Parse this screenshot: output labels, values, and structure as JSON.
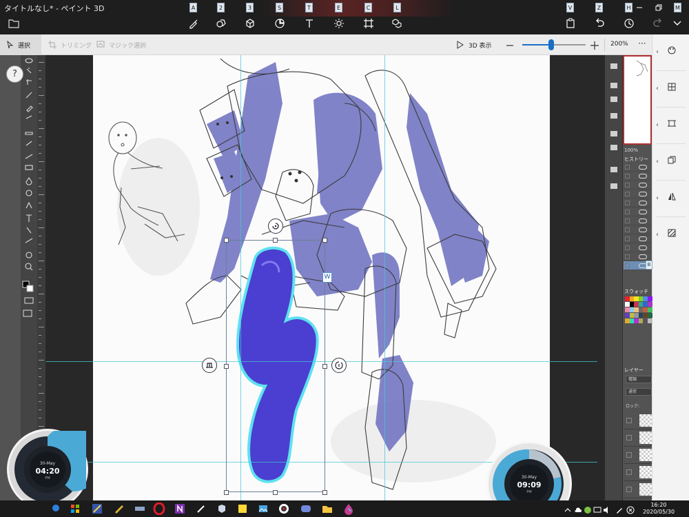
{
  "app": {
    "title": "タイトルなし* - ペイント 3D"
  },
  "toolbar": {
    "tools": [
      {
        "key": "A",
        "icon": "brushes-icon",
        "name": "brushes"
      },
      {
        "key": "2",
        "icon": "2d-shapes-icon",
        "name": "2d-shapes"
      },
      {
        "key": "3",
        "icon": "3d-shapes-icon",
        "name": "3d-shapes"
      },
      {
        "key": "S",
        "icon": "stickers-icon",
        "name": "stickers"
      },
      {
        "key": "T",
        "icon": "text-icon",
        "name": "text"
      },
      {
        "key": "E",
        "icon": "effects-icon",
        "name": "effects"
      },
      {
        "key": "C",
        "icon": "canvas-icon",
        "name": "canvas"
      },
      {
        "key": "L",
        "icon": "3d-library-icon",
        "name": "3d-library"
      }
    ],
    "right_tools": [
      {
        "key": "V",
        "icon": "paste-icon",
        "name": "paste"
      },
      {
        "key": "Z",
        "icon": "undo-icon",
        "name": "undo"
      },
      {
        "key": "H",
        "icon": "history-icon",
        "name": "history"
      },
      {
        "key": "M",
        "icon": "menu-expand-icon",
        "name": "expand"
      }
    ]
  },
  "commandbar": {
    "select_label": "選択",
    "trim_label": "トリミング",
    "magic_select_label": "マジック選択",
    "view3d_label": "3D 表示",
    "zoom_label": "200%",
    "zoom_level": 0.46,
    "more_label": "···"
  },
  "right_panel": {
    "items": [
      "paint-icon",
      "grid-icon",
      "frame-icon",
      "copy-icon",
      "flip-icon",
      "texture-icon"
    ]
  },
  "help": {
    "label": "?"
  },
  "selection": {
    "width_label": "W"
  },
  "photoshop": {
    "nav_zoom": "100%",
    "history_title": "ヒストリー",
    "swatches_title": "スウォッチ",
    "layers_title": "レイヤー",
    "layer_kind": "種類",
    "layer_mode": "通常",
    "lock_label": "ロック:",
    "b_badge": "B"
  },
  "clock_left": {
    "date": "30-May",
    "time": "04:20",
    "ampm": "PM"
  },
  "clock_right": {
    "date": "30-May",
    "time": "09:09",
    "ampm": "PM"
  },
  "taskbar": {
    "time": "16:20",
    "date": "2020/05/30",
    "apps": [
      "start-icon",
      "search-icon",
      "task-view-icon",
      "store-icon",
      "pinned-app-1-icon",
      "pinned-app-2-icon",
      "pinned-app-3-icon",
      "opera-icon",
      "onenote-icon",
      "pen-icon",
      "paint3d-icon",
      "sticky-notes-icon",
      "photos-icon",
      "media-player-icon",
      "discord-icon",
      "file-explorer-icon",
      "color-drop-icon"
    ]
  },
  "colors": {
    "titlebar_bg": "#1e1e1e",
    "accent_blue": "#1a6fc4",
    "figure_shade": "#6b6fbf",
    "guide_cyan": "#47c5d8",
    "clock_blue": "#4ba9d6"
  }
}
